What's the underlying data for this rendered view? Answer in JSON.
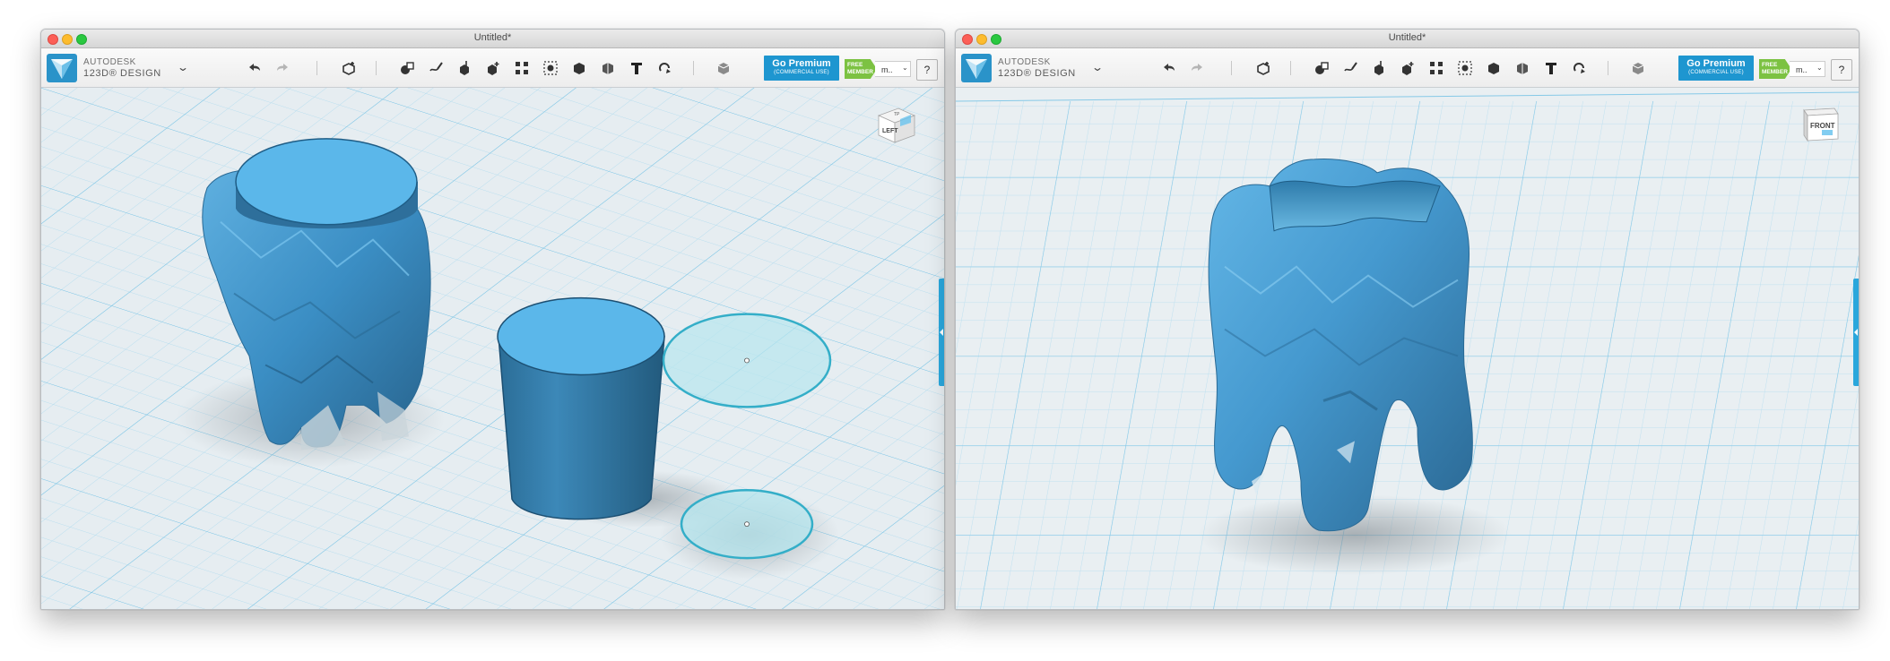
{
  "colors": {
    "accent": "#1e96d0",
    "object_fill": "#5bb7ea",
    "object_shade": "#3d87b9",
    "grid_major": "#9fd4ee",
    "grid_minor": "#cde6f2",
    "sketch_fill": "#b6e6ee",
    "sketch_stroke": "#34aec8",
    "member_green": "#7cc242"
  },
  "windows": [
    {
      "title": "Untitled*",
      "app": {
        "brand_top": "AUTODESK",
        "brand_bottom": "123D® DESIGN",
        "dropdown": "⌄"
      },
      "toolbar": {
        "undo_icon": "undo-icon",
        "redo_icon": "redo-icon",
        "tools_icon_names": [
          "transform",
          "primitives",
          "sketch",
          "construct",
          "modify",
          "pattern",
          "grouping",
          "combine",
          "measure",
          "text",
          "snap",
          "material"
        ]
      },
      "premium": {
        "label": "Go Premium",
        "sub": "(COMMERCIAL USE)"
      },
      "member": {
        "badge_line1": "FREE",
        "badge_line2": "MEMBER",
        "name": "m..",
        "chevron": "⌄"
      },
      "help": "?",
      "viewcube": {
        "face": "LEFT",
        "top_face": "TP"
      }
    },
    {
      "title": "Untitled*",
      "app": {
        "brand_top": "AUTODESK",
        "brand_bottom": "123D® DESIGN",
        "dropdown": "⌄"
      },
      "premium": {
        "label": "Go Premium",
        "sub": "(COMMERCIAL USE)"
      },
      "member": {
        "badge_line1": "FREE",
        "badge_line2": "MEMBER",
        "name": "m..",
        "chevron": "⌄"
      },
      "help": "?",
      "viewcube": {
        "face": "FRONT",
        "top_face": ""
      }
    }
  ]
}
